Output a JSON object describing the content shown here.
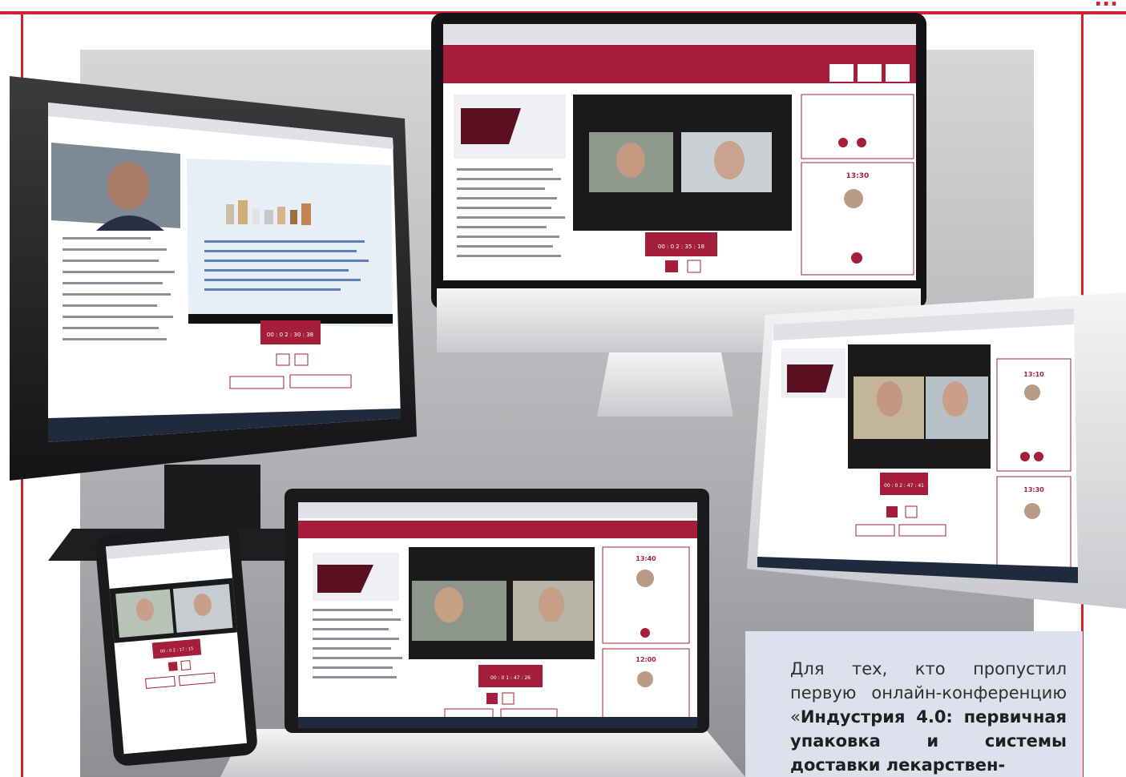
{
  "heading": {
    "visible_fragment": "..."
  },
  "caption": {
    "text_before": "Для тех, кто пропустил первую онлайн-конферен­цию «",
    "bold_text": "Индустрия 4.0: пер­вичная упаковка и систе­мы доставки лекарствен-"
  },
  "devices": [
    {
      "kind": "desktop-monitor",
      "timer": "00 : 0 2 : 30 : 38"
    },
    {
      "kind": "imac",
      "timer": "00 : 0 2 : 35 : 18",
      "slot_time": "13:30"
    },
    {
      "kind": "monitor-right",
      "slot_times": [
        "13:10",
        "13:30"
      ],
      "timer": "00 : 0 2 : 47 : 41"
    },
    {
      "kind": "laptop",
      "slot_times": [
        "13:40",
        "12:00"
      ],
      "timer": "00 : 0 1 : 47 : 26"
    },
    {
      "kind": "phone",
      "timer": "00 : 0 2 : 17 : 15"
    }
  ],
  "colors": {
    "brand": "#a51f3a",
    "frame": "#d11f2f",
    "caption_bg": "#dfe0ee"
  }
}
